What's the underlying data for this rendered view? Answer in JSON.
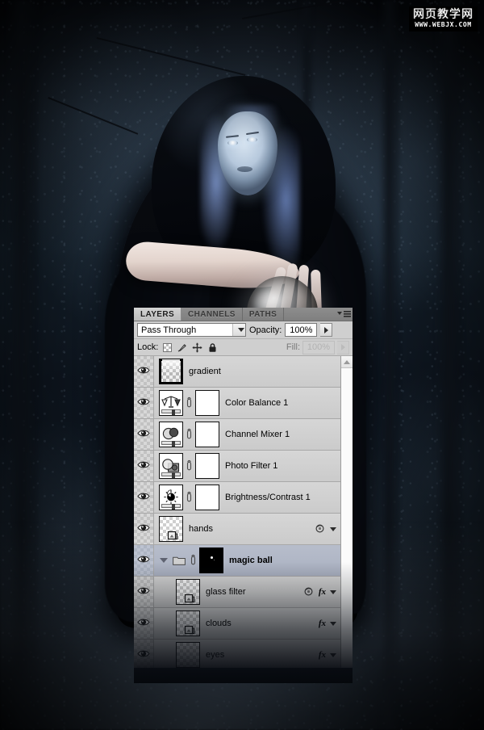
{
  "watermark": {
    "cn": "网页教学网",
    "url": "WWW.WEBJX.COM"
  },
  "artwork": {
    "description": "dark-forest photo manipulation of a hooded witch holding a glowing smoke-filled magic ball",
    "accent_blue": "#8ba0d8",
    "shadow_black": "#04060a"
  },
  "panel": {
    "tabs": [
      {
        "label": "LAYERS",
        "active": true
      },
      {
        "label": "CHANNELS",
        "active": false
      },
      {
        "label": "PATHS",
        "active": false
      }
    ],
    "menu_icon": "panel-menu-icon",
    "blend_mode": {
      "value": "Pass Through",
      "arrow_icon": "chevron-down-icon"
    },
    "opacity": {
      "label": "Opacity:",
      "value": "100%",
      "arrow_icon": "play-arrow-icon"
    },
    "lock": {
      "label": "Lock:",
      "icons": [
        "lock-transparent-pixels-icon",
        "lock-image-pixels-icon",
        "lock-position-icon",
        "lock-all-icon"
      ]
    },
    "fill": {
      "label": "Fill:",
      "value": "100%",
      "disabled": true,
      "arrow_icon": "play-arrow-icon"
    },
    "scrollbar": {
      "up_arrow_icon": "scroll-up-arrow-icon"
    },
    "layers": [
      {
        "name": "gradient",
        "visible": true,
        "thumb": "gradient",
        "kind": "pixel",
        "selected": false,
        "bold": false,
        "has_mask": false,
        "mask_link": false,
        "fx": false,
        "style_icon": false,
        "expand_caret": false,
        "indent": false
      },
      {
        "name": "Color Balance 1",
        "visible": true,
        "thumb": "balance",
        "kind": "adjustment",
        "selected": false,
        "bold": false,
        "has_mask": true,
        "mask_link": true,
        "fx": false,
        "style_icon": false,
        "expand_caret": false,
        "indent": false
      },
      {
        "name": "Channel Mixer 1",
        "visible": true,
        "thumb": "mixer",
        "kind": "adjustment",
        "selected": false,
        "bold": false,
        "has_mask": true,
        "mask_link": true,
        "fx": false,
        "style_icon": false,
        "expand_caret": false,
        "indent": false
      },
      {
        "name": "Photo Filter 1",
        "visible": true,
        "thumb": "photofilter",
        "kind": "adjustment",
        "selected": false,
        "bold": false,
        "has_mask": true,
        "mask_link": true,
        "fx": false,
        "style_icon": false,
        "expand_caret": false,
        "indent": false
      },
      {
        "name": "Brightness/Contrast 1",
        "visible": true,
        "thumb": "brightness",
        "kind": "adjustment",
        "selected": false,
        "bold": false,
        "has_mask": true,
        "mask_link": true,
        "fx": false,
        "style_icon": false,
        "expand_caret": false,
        "indent": false
      },
      {
        "name": "hands",
        "visible": true,
        "thumb": "transparent",
        "kind": "pixel",
        "selected": false,
        "bold": false,
        "has_mask": false,
        "mask_link": false,
        "fx": false,
        "style_icon": true,
        "expand_caret": false,
        "indent": false
      },
      {
        "name": "magic ball",
        "visible": true,
        "thumb": "folder-mask",
        "kind": "group",
        "selected": true,
        "bold": true,
        "has_mask": true,
        "mask_link": true,
        "fx": false,
        "style_icon": false,
        "expand_caret": true,
        "indent": false
      },
      {
        "name": "glass filter",
        "visible": true,
        "thumb": "transparent",
        "kind": "pixel",
        "selected": false,
        "bold": false,
        "has_mask": false,
        "mask_link": false,
        "fx": true,
        "style_icon": true,
        "expand_caret": false,
        "indent": true
      },
      {
        "name": "clouds",
        "visible": true,
        "thumb": "transparent",
        "kind": "pixel",
        "selected": false,
        "bold": false,
        "has_mask": false,
        "mask_link": false,
        "fx": true,
        "style_icon": false,
        "expand_caret": false,
        "indent": true
      },
      {
        "name": "eyes",
        "visible": true,
        "thumb": "transparent",
        "kind": "pixel",
        "selected": false,
        "bold": false,
        "has_mask": false,
        "mask_link": false,
        "fx": true,
        "style_icon": false,
        "expand_caret": false,
        "indent": true
      }
    ]
  }
}
